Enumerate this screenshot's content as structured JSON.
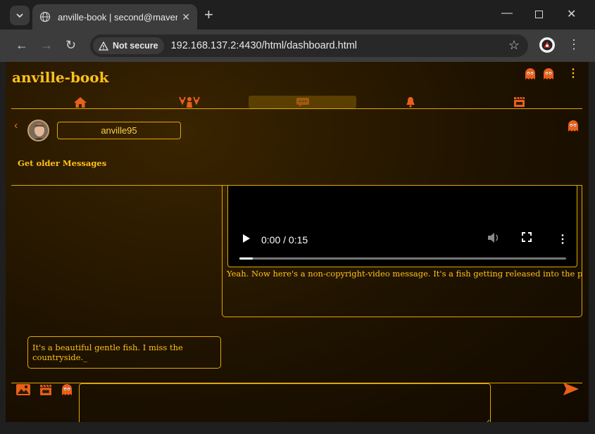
{
  "browser": {
    "tab_title": "anville-book | second@maven.c",
    "new_tab": "+",
    "security_label": "Not secure",
    "url": "192.168.137.2:4430/html/dashboard.html"
  },
  "app": {
    "title": "anville-book",
    "kebab": "⋮",
    "nav": [
      "home-icon",
      "friends-icon",
      "messages-icon",
      "notifications-icon",
      "clapperboard-icon"
    ],
    "active_nav": "messages-icon"
  },
  "chat": {
    "back": "‹",
    "username": "anville95",
    "older_messages": "Get older Messages",
    "messages": [
      {
        "direction": "outgoing",
        "video": {
          "time": "0:00 / 0:15",
          "progress": 0.04
        },
        "text": "Yeah. Now here's a non-copyright-video message. It's a fish getting released into the pond._"
      },
      {
        "direction": "incoming",
        "text": "It's a beautiful gentle fish. I miss the countryside._"
      }
    ]
  },
  "composer": {
    "icons": [
      "image-icon",
      "clapperboard-icon",
      "ghost-icon"
    ],
    "input_value": ""
  },
  "colors": {
    "accent": "#ffc21a",
    "border": "#e0a800",
    "icon_orange": "#e8601a"
  }
}
